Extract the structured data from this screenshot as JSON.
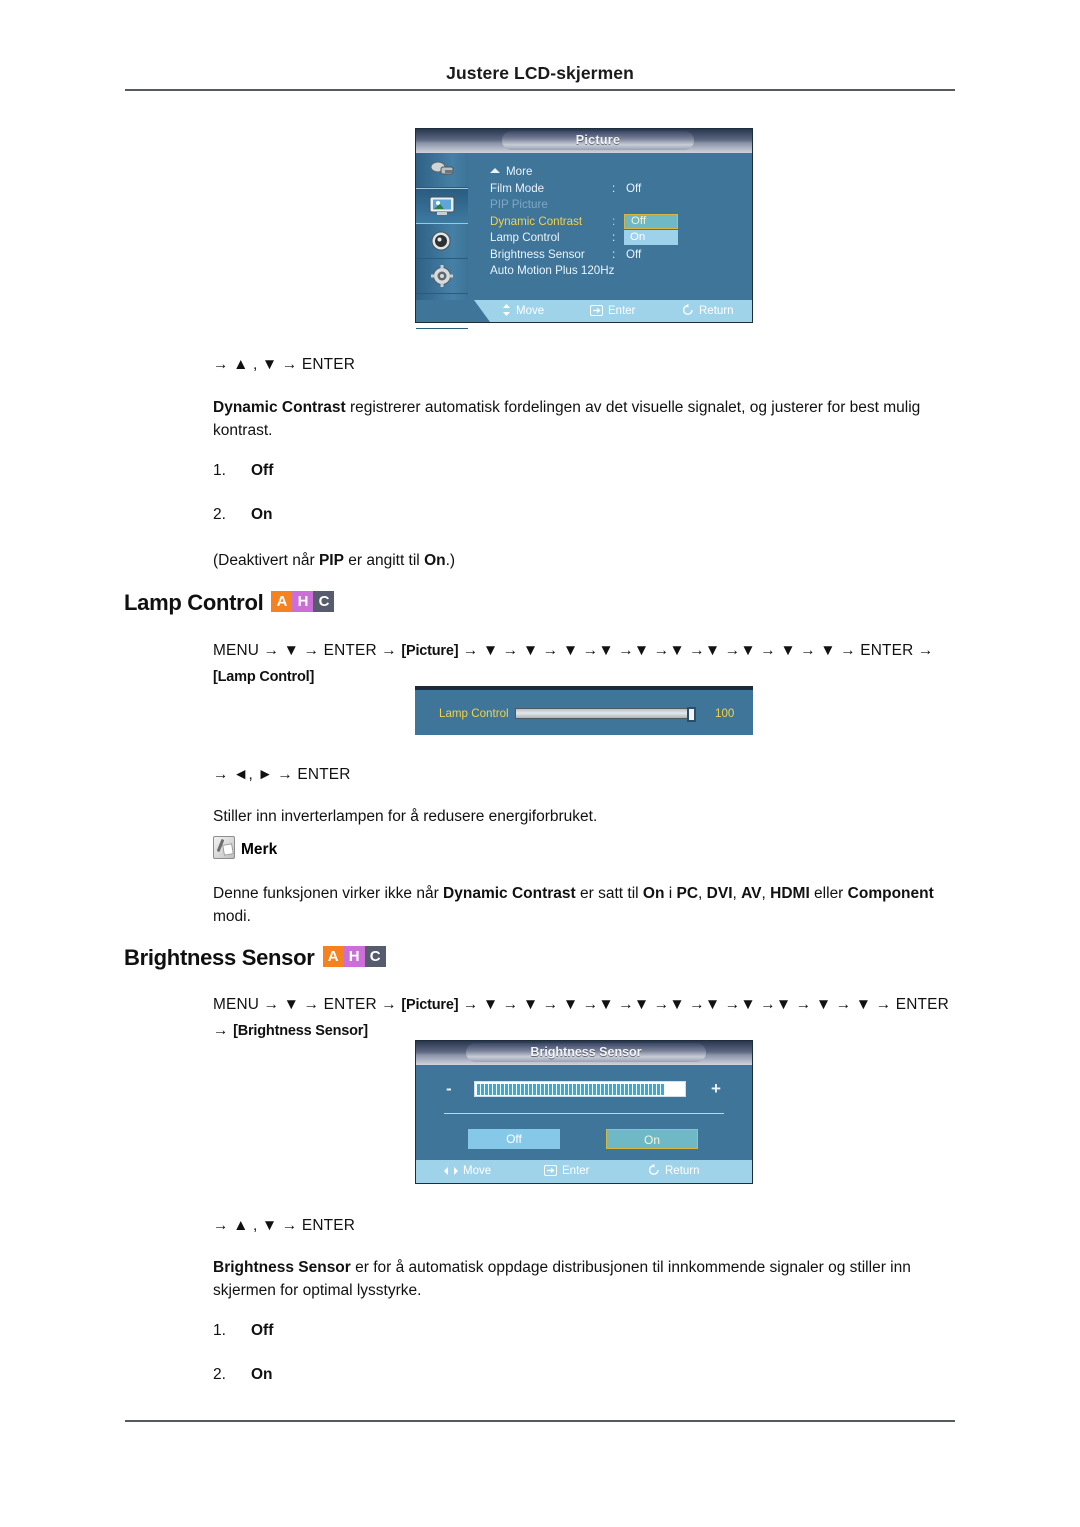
{
  "header": {
    "title": "Justere LCD-skjermen"
  },
  "osd_picture": {
    "title": "Picture",
    "rows": [
      {
        "label": "More",
        "value": ""
      },
      {
        "label": "Film Mode",
        "value": "Off"
      },
      {
        "label": "PIP Picture",
        "value": ""
      },
      {
        "label": "Dynamic Contrast",
        "value": ""
      },
      {
        "label": "Lamp Control",
        "value": ""
      },
      {
        "label": "Brightness Sensor",
        "value": "Off"
      },
      {
        "label": "Auto Motion Plus 120Hz",
        "value": ""
      }
    ],
    "highlight_off": "Off",
    "highlight_on": "On",
    "footer": {
      "move": "Move",
      "enter": "Enter",
      "return": "Return"
    },
    "sidebar_icons": [
      "input-icon",
      "picture-icon",
      "sound-icon",
      "setup-icon",
      "multi-control-icon"
    ],
    "colors": {
      "panel": "#3f7599",
      "highlight_border": "#d8b640",
      "selected_label": "#f3d24b"
    }
  },
  "section_dynamic_contrast": {
    "nav": "→ ▲ , ▼ → ENTER",
    "paragraph_bold": "Dynamic Contrast",
    "paragraph_rest": "  registrerer automatisk fordelingen av det visuelle signalet, og justerer for best mulig kontrast.",
    "items": [
      {
        "num": "1.",
        "value": "Off"
      },
      {
        "num": "2.",
        "value": "On"
      }
    ],
    "note_pre": "(Deaktivert når ",
    "note_bold1": "PIP",
    "note_mid": " er angitt til ",
    "note_bold2": "On",
    "note_post": ".)"
  },
  "section_lamp_control": {
    "heading": "Lamp Control",
    "badges": [
      "A",
      "H",
      "C"
    ],
    "menu_path_prefix": "MENU → ▼ → ENTER → ",
    "menu_path_box1": "[Picture]",
    "menu_path_middle": " → ▼ → ▼ → ▼ →▼ →▼ →▼ →▼ →▼ → ▼ → ▼ → ENTER → ",
    "menu_path_box2": "[Lamp Control]",
    "osd": {
      "label": "Lamp Control",
      "value": "100"
    },
    "nav": "→ ◄, ► → ENTER",
    "description": "Stiller inn inverterlampen for å redusere energiforbruket.",
    "note_label": "Merk",
    "note_pre": "Denne funksjonen virker ikke når ",
    "note_bold1": "Dynamic Contrast",
    "note_mid1": " er satt til ",
    "note_bold2": "On",
    "note_mid2": " i ",
    "note_bold3": "PC",
    "note_mid3": ", ",
    "note_bold4": "DVI",
    "note_mid4": ", ",
    "note_bold5": "AV",
    "note_mid5": ", ",
    "note_bold6": "HDMI",
    "note_mid6": " eller ",
    "note_bold7": "Component",
    "note_post": " modi."
  },
  "section_brightness_sensor": {
    "heading": "Brightness Sensor",
    "badges": [
      "A",
      "H",
      "C"
    ],
    "menu_path_prefix": "MENU → ▼ → ENTER → ",
    "menu_path_box1": "[Picture]",
    "menu_path_middle": " → ▼ → ▼ → ▼ →▼ →▼ →▼ →▼ →▼ →▼ → ▼ → ▼ → ENTER → ",
    "menu_path_box2": "[Brightness Sensor]",
    "osd": {
      "title": "Brightness Sensor",
      "minus": "-",
      "plus": "+",
      "off_label": "Off",
      "on_label": "On",
      "footer": {
        "move": "Move",
        "enter": "Enter",
        "return": "Return"
      },
      "segments": 47
    },
    "nav": "→ ▲ , ▼ → ENTER",
    "paragraph_bold": "Brightness Sensor",
    "paragraph_rest": " er for å automatisk oppdage distribusjonen til innkommende signaler og stiller inn skjermen for optimal lysstyrke.",
    "items": [
      {
        "num": "1.",
        "value": "Off"
      },
      {
        "num": "2.",
        "value": "On"
      }
    ]
  }
}
